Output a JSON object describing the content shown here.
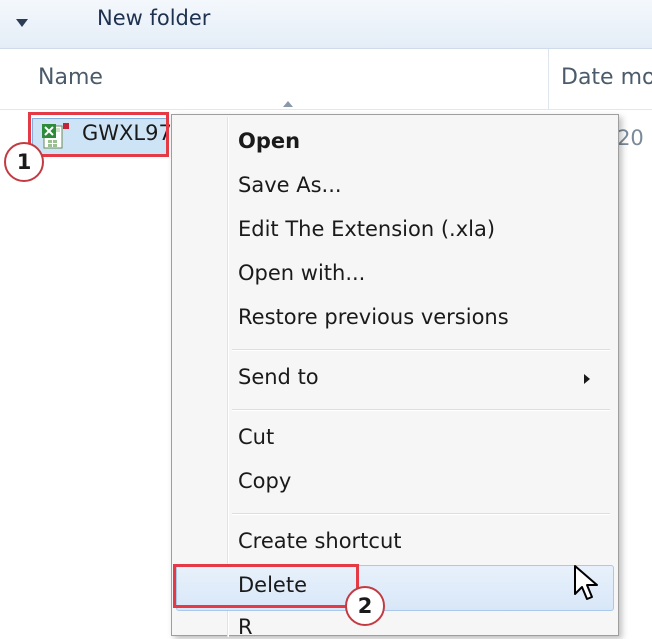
{
  "toolbar": {
    "title": "New folder"
  },
  "header": {
    "col_name": "Name",
    "col_date": "Date mo"
  },
  "file": {
    "name": "GWXL97",
    "date_partial": "/20",
    "icon": "excel-addin-icon"
  },
  "callouts": {
    "step1": "1",
    "step2": "2"
  },
  "context_menu": {
    "items": [
      {
        "label": "Open"
      },
      {
        "label": "Save As..."
      },
      {
        "label": "Edit The Extension (.xla)"
      },
      {
        "label": "Open with..."
      },
      {
        "label": "Restore previous versions"
      },
      {
        "label": "Send to"
      },
      {
        "label": "Cut"
      },
      {
        "label": "Copy"
      },
      {
        "label": "Create shortcut"
      },
      {
        "label": "Delete"
      },
      {
        "label": "R"
      }
    ]
  },
  "colors": {
    "highlight_red": "#e53a45",
    "selection_blue": "#cde4f7",
    "hover_blue": "#d8e7f8"
  }
}
